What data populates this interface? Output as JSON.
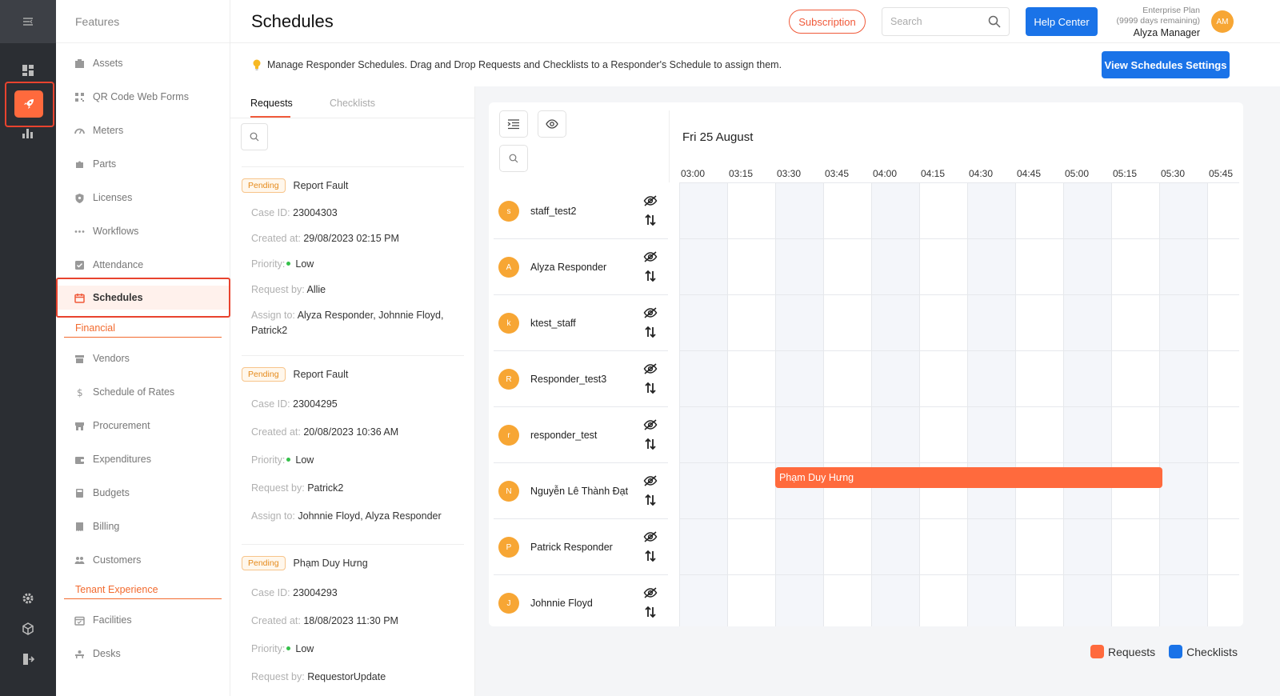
{
  "header": {
    "title": "Schedules",
    "subscription_label": "Subscription",
    "search_placeholder": "Search",
    "help_label": "Help Center",
    "plan_name": "Enterprise Plan",
    "plan_days": "(9999 days remaining)",
    "user_name": "Alyza Manager",
    "user_initials": "AM"
  },
  "sidebar": {
    "title": "Features",
    "items": [
      {
        "label": "Assets",
        "icon": "box-icon"
      },
      {
        "label": "QR Code Web Forms",
        "icon": "qr-icon"
      },
      {
        "label": "Meters",
        "icon": "gauge-icon"
      },
      {
        "label": "Parts",
        "icon": "puzzle-icon"
      },
      {
        "label": "Licenses",
        "icon": "shield-icon"
      },
      {
        "label": "Workflows",
        "icon": "dots-icon"
      },
      {
        "label": "Attendance",
        "icon": "check-square-icon"
      },
      {
        "label": "Schedules",
        "icon": "calendar-icon"
      }
    ],
    "section_financial": "Financial",
    "financial_items": [
      {
        "label": "Vendors",
        "icon": "store-icon"
      },
      {
        "label": "Schedule of Rates",
        "icon": "dollar-icon"
      },
      {
        "label": "Procurement",
        "icon": "cart-icon"
      },
      {
        "label": "Expenditures",
        "icon": "wallet-icon"
      },
      {
        "label": "Budgets",
        "icon": "calculator-icon"
      },
      {
        "label": "Billing",
        "icon": "receipt-icon"
      },
      {
        "label": "Customers",
        "icon": "users-icon"
      }
    ],
    "section_tenant": "Tenant Experience",
    "tenant_items": [
      {
        "label": "Facilities",
        "icon": "calendar-check-icon"
      },
      {
        "label": "Desks",
        "icon": "desk-icon"
      }
    ]
  },
  "infobar": {
    "message": "Manage Responder Schedules. Drag and Drop Requests and Checklists to a Responder's Schedule to assign them.",
    "view_settings_label": "View Schedules Settings"
  },
  "requests": {
    "tabs": [
      "Requests",
      "Checklists"
    ],
    "cards": [
      {
        "status": "Pending",
        "name": "Report Fault",
        "case_label": "Case ID:",
        "case_id": "23004303",
        "created_label": "Created at:",
        "created": "29/08/2023 02:15 PM",
        "priority_label": "Priority:",
        "priority": "Low",
        "request_label": "Request by:",
        "request_by": "Allie",
        "assign_label": "Assign to:",
        "assign_to": "Alyza Responder, Johnnie Floyd, Patrick2"
      },
      {
        "status": "Pending",
        "name": "Report Fault",
        "case_label": "Case ID:",
        "case_id": "23004295",
        "created_label": "Created at:",
        "created": "20/08/2023 10:36 AM",
        "priority_label": "Priority:",
        "priority": "Low",
        "request_label": "Request by:",
        "request_by": "Patrick2",
        "assign_label": "Assign to:",
        "assign_to": "Johnnie Floyd, Alyza Responder"
      },
      {
        "status": "Pending",
        "name": "Phạm Duy Hưng",
        "case_label": "Case ID:",
        "case_id": "23004293",
        "created_label": "Created at:",
        "created": "18/08/2023 11:30 PM",
        "priority_label": "Priority:",
        "priority": "Low",
        "request_label": "Request by:",
        "request_by": "RequestorUpdate"
      }
    ]
  },
  "schedule": {
    "date": "Fri 25 August",
    "times": [
      "03:00",
      "03:15",
      "03:30",
      "03:45",
      "04:00",
      "04:15",
      "04:30",
      "04:45",
      "05:00",
      "05:15",
      "05:30",
      "05:45"
    ],
    "responders": [
      {
        "initial": "s",
        "name": "staff_test2"
      },
      {
        "initial": "A",
        "name": "Alyza Responder"
      },
      {
        "initial": "k",
        "name": "ktest_staff"
      },
      {
        "initial": "R",
        "name": "Responder_test3"
      },
      {
        "initial": "r",
        "name": "responder_test"
      },
      {
        "initial": "N",
        "name": "Nguyễn Lê Thành Đạt"
      },
      {
        "initial": "P",
        "name": "Patrick Responder"
      },
      {
        "initial": "J",
        "name": "Johnnie Floyd"
      }
    ],
    "event": {
      "label": "Phạm Duy Hưng",
      "responder": "Nguyễn Lê Thành Đạt",
      "start": "03:30",
      "end": "05:30"
    }
  },
  "legend": {
    "requests": "Requests",
    "checklists": "Checklists"
  },
  "colors": {
    "accent": "#ff6a3d",
    "primary": "#1a73e8",
    "checklists": "#1a73e8",
    "pending": "#e58a1a"
  }
}
